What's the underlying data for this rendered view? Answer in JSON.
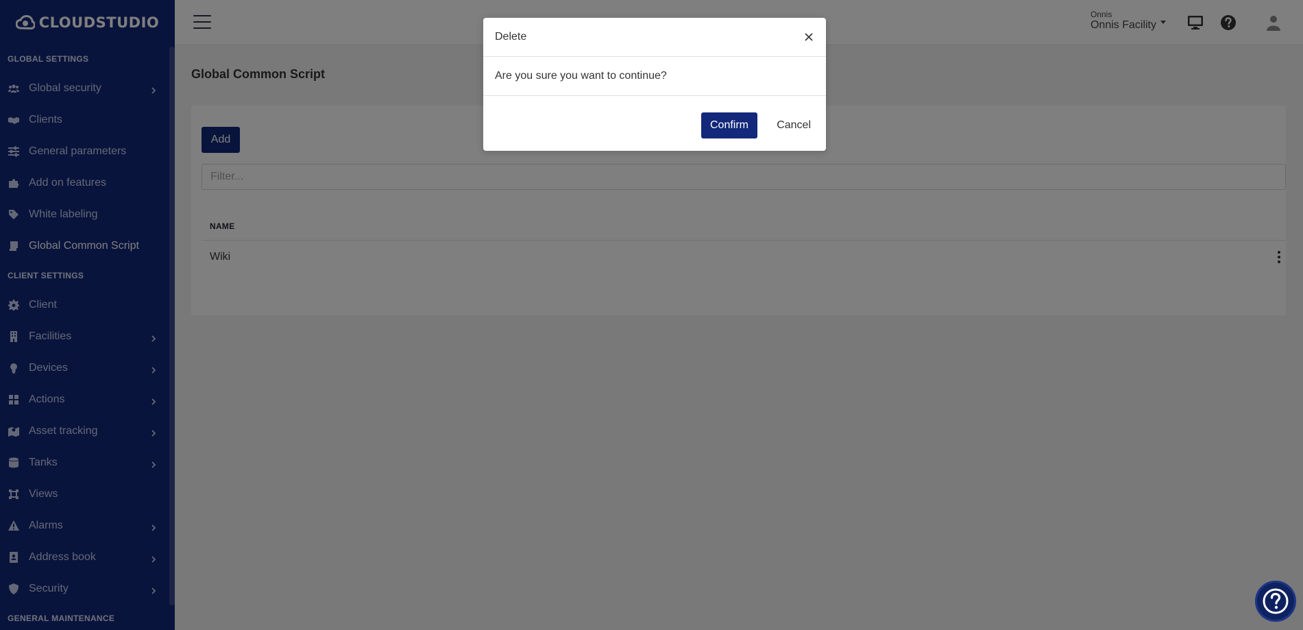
{
  "app": {
    "logo_text": "CLOUDSTUDIO"
  },
  "sidebar": {
    "sections": [
      {
        "title": "GLOBAL SETTINGS",
        "items": [
          {
            "label": "Global security",
            "icon": "users-icon",
            "has_submenu": true
          },
          {
            "label": "Clients",
            "icon": "handshake-icon",
            "has_submenu": false
          },
          {
            "label": "General parameters",
            "icon": "sliders-icon",
            "has_submenu": false
          },
          {
            "label": "Add on features",
            "icon": "puzzle-icon",
            "has_submenu": false
          },
          {
            "label": "White labeling",
            "icon": "tag-icon",
            "has_submenu": false
          },
          {
            "label": "Global Common Script",
            "icon": "scroll-icon",
            "has_submenu": false,
            "active": true
          }
        ]
      },
      {
        "title": "CLIENT SETTINGS",
        "items": [
          {
            "label": "Client",
            "icon": "gear-icon",
            "has_submenu": false
          },
          {
            "label": "Facilities",
            "icon": "building-icon",
            "has_submenu": true
          },
          {
            "label": "Devices",
            "icon": "lightbulb-icon",
            "has_submenu": true
          },
          {
            "label": "Actions",
            "icon": "grid-icon",
            "has_submenu": true
          },
          {
            "label": "Asset tracking",
            "icon": "map-icon",
            "has_submenu": true
          },
          {
            "label": "Tanks",
            "icon": "database-icon",
            "has_submenu": true
          },
          {
            "label": "Views",
            "icon": "object-icon",
            "has_submenu": false
          },
          {
            "label": "Alarms",
            "icon": "warning-icon",
            "has_submenu": true
          },
          {
            "label": "Address book",
            "icon": "address-book-icon",
            "has_submenu": true
          },
          {
            "label": "Security",
            "icon": "shield-icon",
            "has_submenu": true
          }
        ]
      },
      {
        "title": "GENERAL MAINTENANCE",
        "items": []
      }
    ]
  },
  "topbar": {
    "account_small": "Onnis",
    "account_facility": "Onnis Facility"
  },
  "main": {
    "page_title": "Global Common Script",
    "add_label": "Add",
    "filter_placeholder": "Filter...",
    "table": {
      "columns": [
        "NAME"
      ],
      "rows": [
        {
          "name": "Wiki"
        }
      ]
    }
  },
  "modal": {
    "title": "Delete",
    "message": "Are you sure you want to continue?",
    "confirm_label": "Confirm",
    "cancel_label": "Cancel"
  },
  "colors": {
    "brand": "#13287a",
    "sidebar_text": "#c9d1ec",
    "overlay": "rgba(0,0,0,0.5)"
  }
}
